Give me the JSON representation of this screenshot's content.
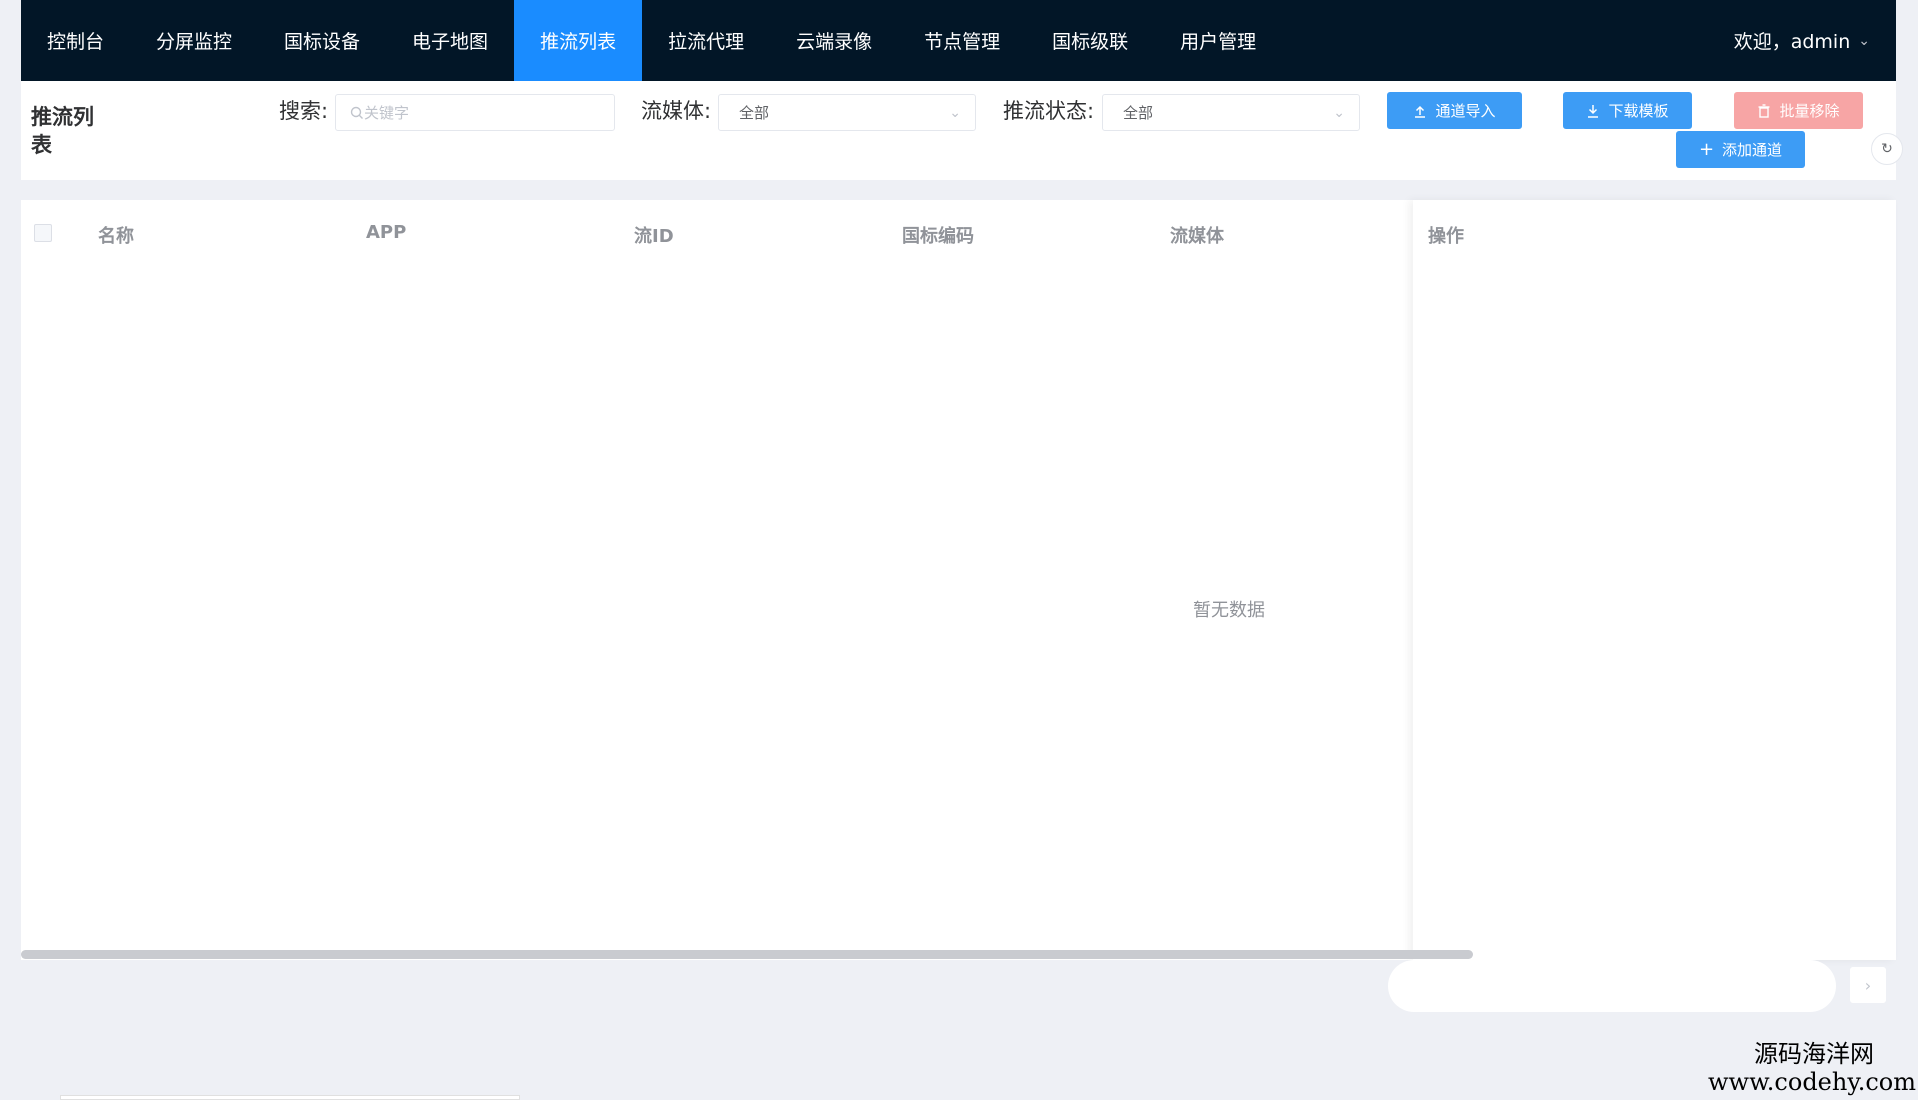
{
  "nav": {
    "items": [
      {
        "label": "控制台"
      },
      {
        "label": "分屏监控"
      },
      {
        "label": "国标设备"
      },
      {
        "label": "电子地图"
      },
      {
        "label": "推流列表"
      },
      {
        "label": "拉流代理"
      },
      {
        "label": "云端录像"
      },
      {
        "label": "节点管理"
      },
      {
        "label": "国标级联"
      },
      {
        "label": "用户管理"
      }
    ],
    "active": "推流列表",
    "user": "欢迎，admin"
  },
  "page": {
    "title": "推流列表"
  },
  "toolbar": {
    "search_label": "搜索:",
    "search_placeholder": "关键字",
    "media_label": "流媒体:",
    "media_value": "全部",
    "status_label": "推流状态:",
    "status_value": "全部",
    "import_button": "通道导入",
    "download_button": "下载模板",
    "batch_remove_button": "批量移除",
    "add_button": "添加通道"
  },
  "table": {
    "columns": [
      "名称",
      "APP",
      "流ID",
      "国标编码",
      "流媒体"
    ],
    "op_column": "操作",
    "empty_text": "暂无数据",
    "rows": []
  },
  "watermark": {
    "line1": "源码海洋网",
    "line2": "www.codehy.com"
  },
  "colors": {
    "nav_bg": "#021627",
    "nav_active": "#1a8cff",
    "primary": "#3d9cf5",
    "danger_disabled": "#f7a5a5"
  }
}
